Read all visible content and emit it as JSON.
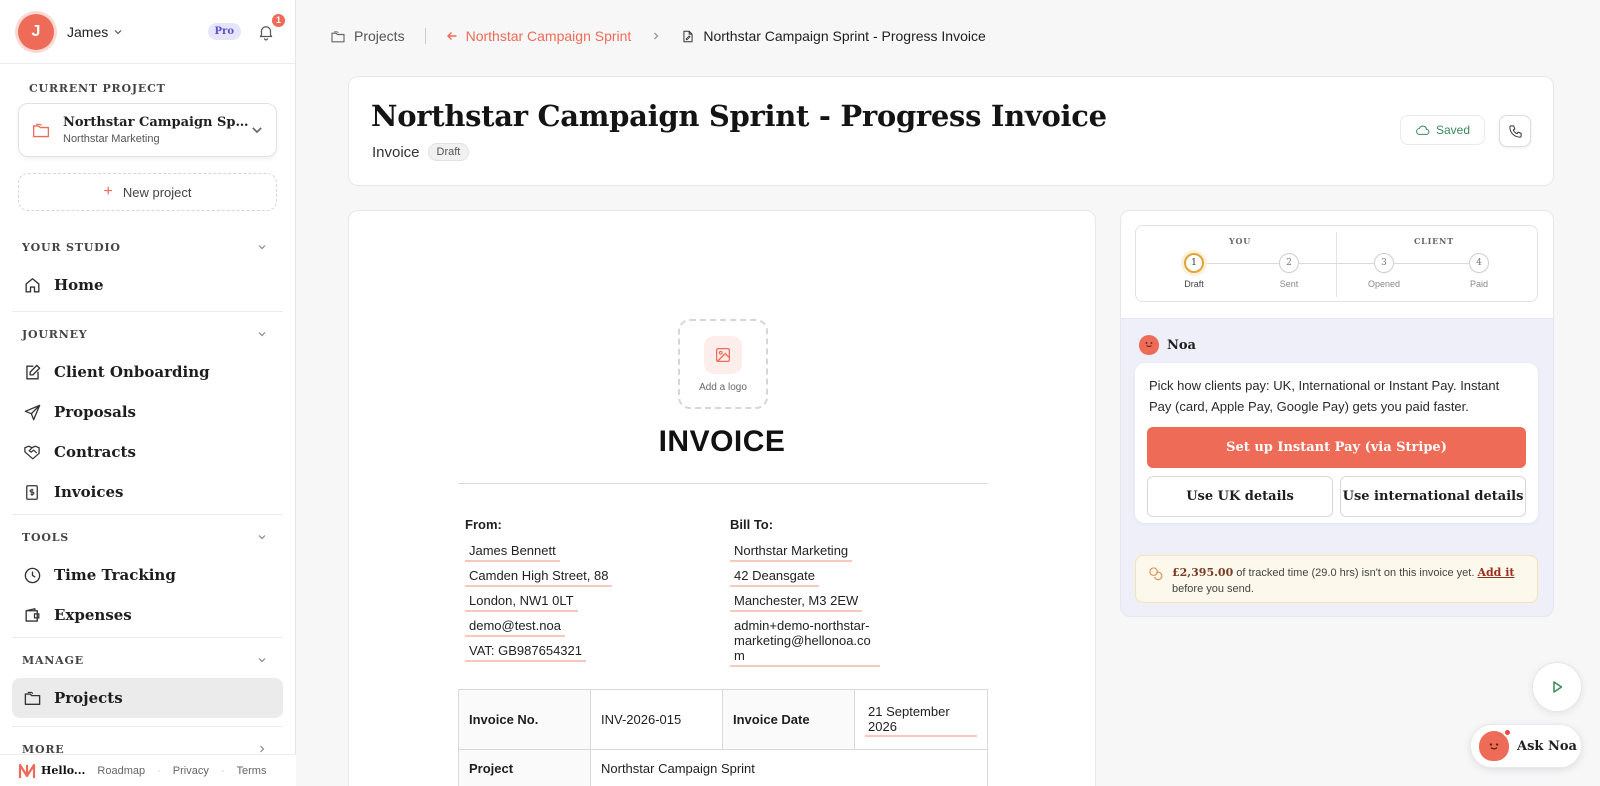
{
  "user": {
    "initial": "J",
    "name": "James",
    "plan": "Pro",
    "notifications": "1"
  },
  "sidebar": {
    "current_project_label": "CURRENT PROJECT",
    "current_project": {
      "title": "Northstar Campaign Sprint",
      "client": "Northstar Marketing"
    },
    "new_project_label": "New project",
    "sections": [
      {
        "title": "YOUR STUDIO",
        "items": [
          {
            "label": "Home",
            "icon": "home-icon"
          }
        ]
      },
      {
        "title": "JOURNEY",
        "items": [
          {
            "label": "Client Onboarding",
            "icon": "edit-icon"
          },
          {
            "label": "Proposals",
            "icon": "send-icon"
          },
          {
            "label": "Contracts",
            "icon": "handshake-icon"
          },
          {
            "label": "Invoices",
            "icon": "invoice-icon"
          }
        ]
      },
      {
        "title": "TOOLS",
        "items": [
          {
            "label": "Time Tracking",
            "icon": "clock-icon"
          },
          {
            "label": "Expenses",
            "icon": "wallet-icon"
          }
        ]
      },
      {
        "title": "MANAGE",
        "items": [
          {
            "label": "Projects",
            "icon": "folder-icon",
            "active": true
          }
        ]
      },
      {
        "title": "MORE",
        "items": []
      }
    ],
    "footer": {
      "brand": "Hello...",
      "links": [
        "Roadmap",
        "Privacy",
        "Terms"
      ]
    }
  },
  "breadcrumb": {
    "root": "Projects",
    "back": "Northstar Campaign Sprint",
    "current": "Northstar Campaign Sprint - Progress Invoice"
  },
  "header": {
    "title": "Northstar Campaign Sprint - Progress Invoice",
    "doc_type": "Invoice",
    "status": "Draft",
    "saved_label": "Saved"
  },
  "invoice": {
    "add_logo_label": "Add a logo",
    "heading": "INVOICE",
    "from_label": "From:",
    "from": [
      "James Bennett",
      "Camden High Street, 88",
      "London, NW1 0LT",
      "demo@test.noa",
      "VAT: GB987654321"
    ],
    "bill_to_label": "Bill To:",
    "bill_to": [
      "Northstar Marketing",
      "42 Deansgate",
      "Manchester, M3 2EW",
      "admin+demo-northstar-marketing@hellonoa.com"
    ],
    "number_label": "Invoice No.",
    "number": "INV-2026-015",
    "date_label": "Invoice Date",
    "date": "21 September 2026",
    "project_label": "Project",
    "project": "Northstar Campaign Sprint"
  },
  "progress": {
    "you_label": "YOU",
    "client_label": "CLIENT",
    "steps": [
      {
        "n": "1",
        "label": "Draft",
        "active": true
      },
      {
        "n": "2",
        "label": "Sent"
      },
      {
        "n": "3",
        "label": "Opened"
      },
      {
        "n": "4",
        "label": "Paid"
      }
    ]
  },
  "assistant": {
    "name": "Noa",
    "message": "Pick how clients pay: UK, International or Instant Pay. Instant Pay (card, Apple Pay, Google Pay) gets you paid faster.",
    "primary_button": "Set up Instant Pay (via Stripe)",
    "uk_button": "Use UK details",
    "intl_button": "Use international details",
    "tracked_amount": "£2,395.00",
    "tracked_text": " of tracked time (29.0 hrs) isn't on this invoice yet. ",
    "tracked_link": "Add it",
    "tracked_tail": " before you send.",
    "ask_label": "Ask Noa"
  },
  "colors": {
    "accent": "#ee6b57",
    "saved": "#3a8a5a",
    "step_active": "#e0a53a"
  }
}
